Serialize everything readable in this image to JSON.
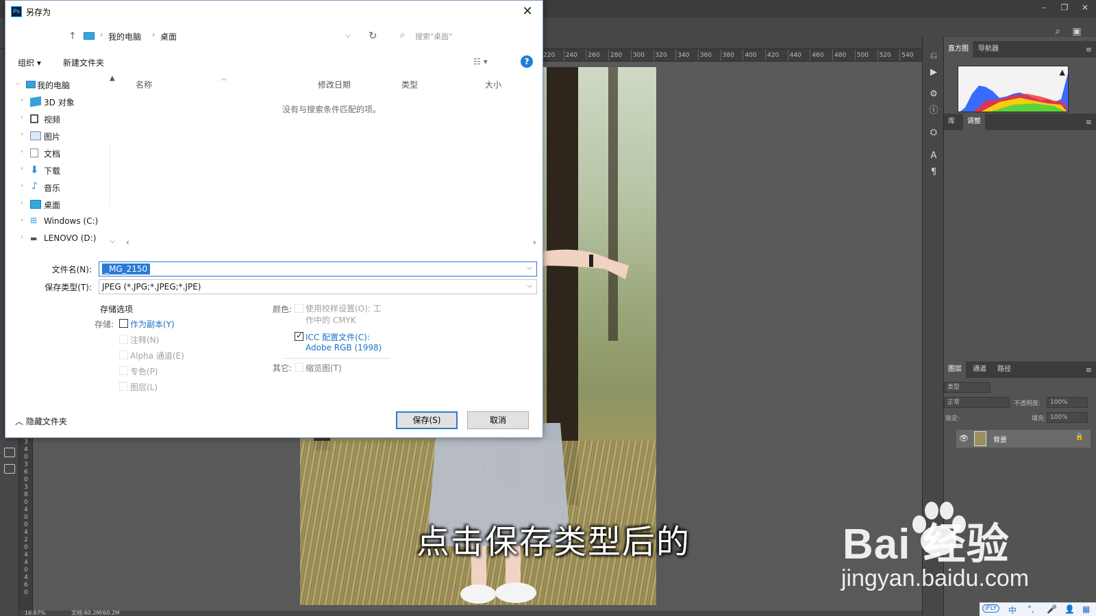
{
  "ps": {
    "ruler_top": [
      "220",
      "240",
      "260",
      "280",
      "300",
      "320",
      "340",
      "360",
      "380",
      "400",
      "420",
      "440",
      "460",
      "480",
      "500",
      "520",
      "540"
    ],
    "ruler_left": [
      "0",
      "3",
      "4",
      "0",
      "3",
      "6",
      "0",
      "3",
      "8",
      "0",
      "4",
      "0",
      "0",
      "4",
      "2",
      "0",
      "4",
      "4",
      "0",
      "4",
      "6",
      "0"
    ],
    "status_zoom": "16.67%",
    "status_doc": "文档:60.2M/60.2M",
    "panel1_tabs": [
      "直方图",
      "导航器"
    ],
    "panel2_tabs": [
      "库",
      "调整"
    ],
    "panel3_tabs": [
      "图层",
      "通道",
      "路径"
    ],
    "layer_filter": "类型",
    "blend_mode": "正常",
    "opacity_label": "不透明度:",
    "opacity_value": "100%",
    "lock_label": "锁定:",
    "fill_label": "填充:",
    "fill_value": "100%",
    "layer_name": "背景"
  },
  "dialog": {
    "title": "另存为",
    "breadcrumb": [
      "我的电脑",
      "桌面"
    ],
    "search_placeholder": "搜索\"桌面\"",
    "organize": "组织 ▾",
    "new_folder": "新建文件夹",
    "help": "?",
    "tree": [
      {
        "label": "我的电脑",
        "icon": "pc-icon",
        "color": "#3aa0d8",
        "expanded": true
      },
      {
        "label": "3D 对象",
        "icon": "cube-icon",
        "color": "#3aa0d8"
      },
      {
        "label": "视频",
        "icon": "video-icon",
        "color": "#555555"
      },
      {
        "label": "图片",
        "icon": "picture-icon",
        "color": "#6b8fb5"
      },
      {
        "label": "文档",
        "icon": "document-icon",
        "color": "#8a8a8a"
      },
      {
        "label": "下载",
        "icon": "download-icon",
        "color": "#2f8fe0"
      },
      {
        "label": "音乐",
        "icon": "music-icon",
        "color": "#2f8fe0"
      },
      {
        "label": "桌面",
        "icon": "desktop-icon",
        "color": "#35a7e0"
      },
      {
        "label": "Windows (C:)",
        "icon": "drive-icon",
        "color": "#3aa0d8"
      },
      {
        "label": "LENOVO (D:)",
        "icon": "drive-icon",
        "color": "#555555"
      }
    ],
    "columns": [
      "名称",
      "修改日期",
      "类型",
      "大小"
    ],
    "empty_message": "没有与搜索条件匹配的项。",
    "filename_label": "文件名(N):",
    "filename_value": "_MG_2150",
    "filetype_label": "保存类型(T):",
    "filetype_value": "JPEG (*.JPG;*.JPEG;*.JPE)",
    "save_options_heading": "存储选项",
    "save_label": "存储:",
    "as_copy": "作为副本(Y)",
    "notes": "注释(N)",
    "alpha": "Alpha 通道(E)",
    "spot": "专色(P)",
    "layers": "图层(L)",
    "color_label": "颜色:",
    "use_proof": "使用校样设置(O): 工作中的 CMYK",
    "icc_line1": "ICC 配置文件(C):",
    "icc_line2": "Adobe RGB (1998)",
    "other_label": "其它:",
    "thumbnail": "缩览图(T)",
    "hide_folders": "隐藏文件夹",
    "save_button": "保存(S)",
    "cancel_button": "取消"
  },
  "overlay": {
    "subtitle": "点击保存类型后的",
    "watermark_brand": "Bai  经验",
    "watermark_url": "jingyan.baidu.com"
  },
  "ime": {
    "items": [
      "中",
      "°,",
      "🎤",
      "👤",
      "▦"
    ]
  }
}
